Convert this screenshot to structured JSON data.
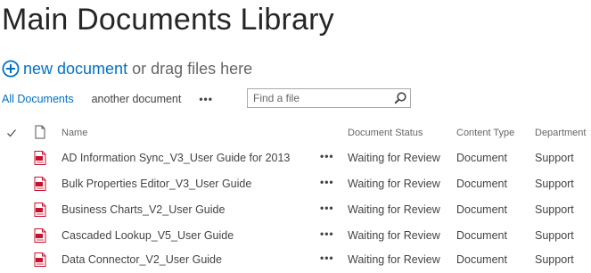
{
  "page": {
    "title": "Main Documents Library"
  },
  "upload": {
    "new_document_label": "new document",
    "drag_text": "or drag files here"
  },
  "views": {
    "items": [
      "All Documents",
      "another document"
    ],
    "more_label": "•••"
  },
  "search": {
    "placeholder": "Find a file",
    "value": ""
  },
  "table": {
    "columns": {
      "name": "Name",
      "document_status": "Document Status",
      "content_type": "Content Type",
      "department": "Department"
    },
    "row_menu_label": "•••",
    "rows": [
      {
        "icon": "pdf-icon",
        "name": "AD Information Sync_V3_User Guide for 2013",
        "document_status": "Waiting for Review",
        "content_type": "Document",
        "department": "Support"
      },
      {
        "icon": "pdf-icon",
        "name": "Bulk Properties Editor_V3_User Guide",
        "document_status": "Waiting for Review",
        "content_type": "Document",
        "department": "Support"
      },
      {
        "icon": "pdf-icon",
        "name": "Business Charts_V2_User Guide",
        "document_status": "Waiting for Review",
        "content_type": "Document",
        "department": "Support"
      },
      {
        "icon": "pdf-icon",
        "name": "Cascaded Lookup_V5_User Guide",
        "document_status": "Waiting for Review",
        "content_type": "Document",
        "department": "Support"
      },
      {
        "icon": "pdf-icon",
        "name": "Data Connector_V2_User Guide",
        "document_status": "Waiting for Review",
        "content_type": "Document",
        "department": "Support"
      }
    ]
  },
  "colors": {
    "accent": "#0072c6",
    "title": "#262626",
    "text": "#444444",
    "pdf_red": "#c8102e"
  }
}
